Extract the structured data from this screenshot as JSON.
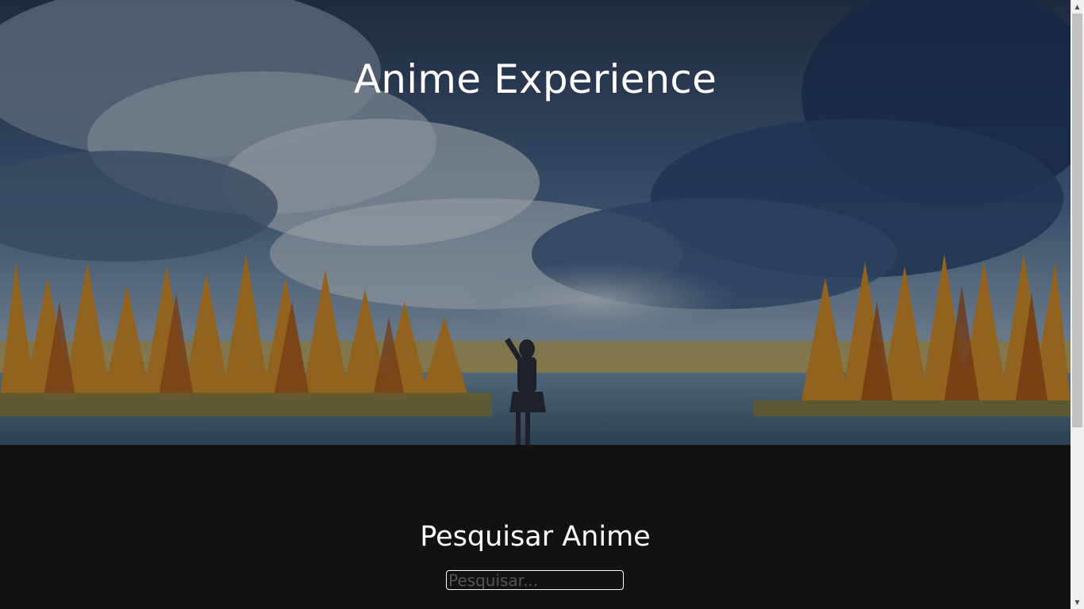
{
  "hero": {
    "title": "Anime Experience",
    "background": "anime landscape: girl by a lake, autumn trees, blue cloudy sky"
  },
  "search": {
    "heading": "Pesquisar Anime",
    "placeholder": "Pesquisar...",
    "value": ""
  },
  "scrollbar": {
    "up_icon": "chevron-up-icon",
    "down_icon": "chevron-down-icon"
  },
  "colors": {
    "page_background": "#121212",
    "text": "#ffffff",
    "input_border": "#ffffff"
  }
}
